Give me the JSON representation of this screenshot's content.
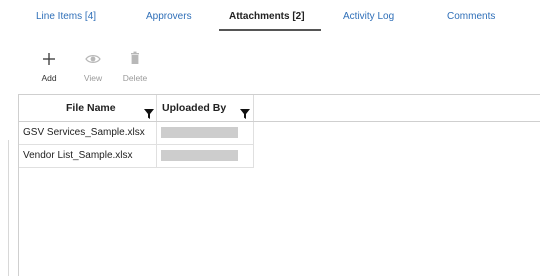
{
  "tabs": [
    {
      "label": "Line Items [4]",
      "active": false
    },
    {
      "label": "Approvers",
      "active": false
    },
    {
      "label": "Attachments [2]",
      "active": true
    },
    {
      "label": "Activity Log",
      "active": false
    },
    {
      "label": "Comments",
      "active": false
    }
  ],
  "toolbar": {
    "add_label": "Add",
    "view_label": "View",
    "delete_label": "Delete",
    "add_icon": "plus-icon",
    "view_icon": "eye-icon",
    "delete_icon": "trash-icon",
    "add_enabled": true,
    "view_enabled": false,
    "delete_enabled": false
  },
  "grid": {
    "columns": [
      {
        "label": "File Name",
        "filter_icon": "filter-icon"
      },
      {
        "label": "Uploaded By",
        "filter_icon": "filter-icon"
      }
    ],
    "rows": [
      {
        "file_name": "GSV Services_Sample.xlsx",
        "uploaded_by_redacted": true
      },
      {
        "file_name": "Vendor List_Sample.xlsx",
        "uploaded_by_redacted": true
      }
    ]
  },
  "colors": {
    "tab_link": "#2f6fb8",
    "tab_active": "#222222",
    "disabled": "#9a9a9a",
    "redaction": "#cdcdcd"
  }
}
